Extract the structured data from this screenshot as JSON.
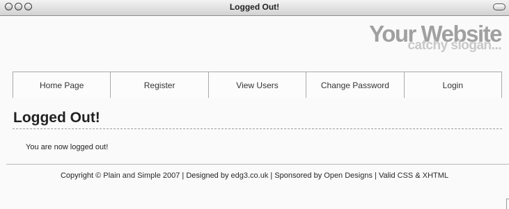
{
  "window": {
    "title": "Logged Out!"
  },
  "header": {
    "site_title": "Your Website",
    "slogan": "catchy slogan..."
  },
  "nav": {
    "items": [
      {
        "label": "Home Page"
      },
      {
        "label": "Register"
      },
      {
        "label": "View Users"
      },
      {
        "label": "Change Password"
      },
      {
        "label": "Login"
      }
    ]
  },
  "main": {
    "heading": "Logged Out!",
    "message": "You are now logged out!"
  },
  "footer": {
    "copyright_prefix": "Copyright © ",
    "plain_and_simple": "Plain and Simple",
    "year_separator": " 2007 | Designed by ",
    "edg3": "edg3.co.uk",
    "sponsored_by": " | Sponsored by ",
    "open_designs": "Open Designs",
    "valid_prefix": " | Valid ",
    "css": "CSS",
    "amp": " & ",
    "xhtml": "XHTML"
  }
}
